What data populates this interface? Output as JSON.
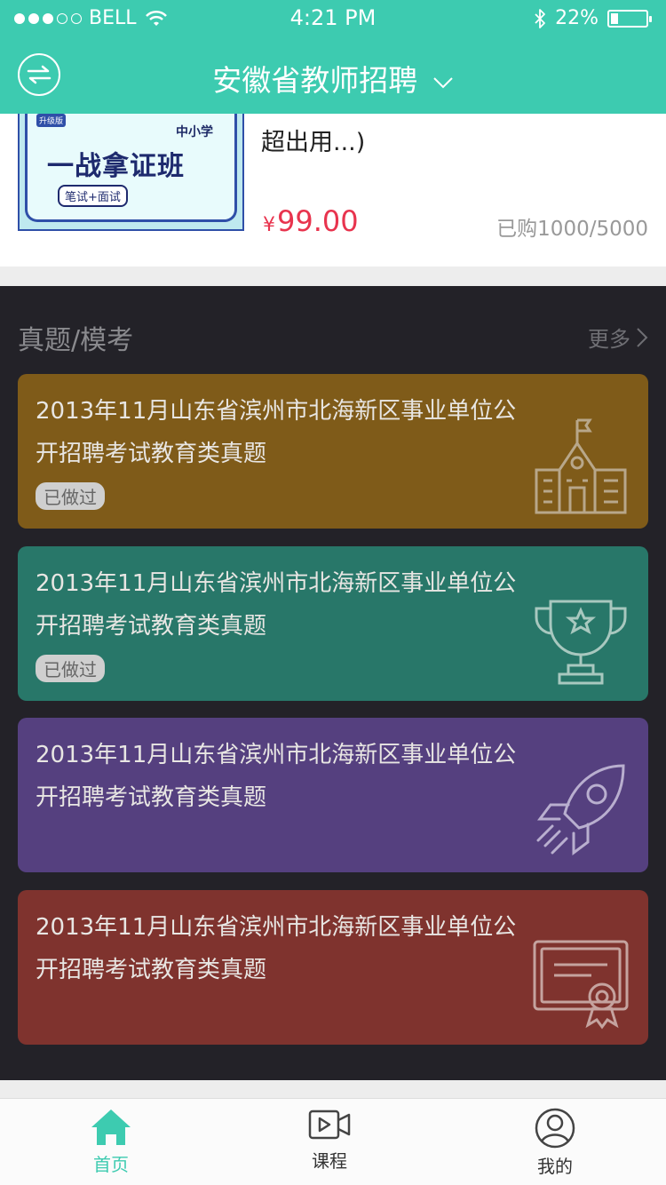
{
  "status_bar": {
    "carrier": "BELL",
    "time": "4:21 PM",
    "battery": "22%",
    "battery_level": 0.22
  },
  "nav": {
    "title": "安徽省教师招聘"
  },
  "product": {
    "image_badge": "升级版",
    "image_school": "中小学",
    "image_main": "一战拿证班",
    "image_sub": "笔试+面试",
    "title_tail": "超出用...)",
    "price": "99.00",
    "currency": "¥",
    "sold": "已购1000/5000"
  },
  "exam_section": {
    "title": "真题/模考",
    "more": "更多",
    "cards": [
      {
        "title": "2013年11月山东省滨州市北海新区事业单位公开招聘考试教育类真题",
        "tag": "已做过",
        "color": "#7F5B19",
        "icon": "school-building-icon"
      },
      {
        "title": "2013年11月山东省滨州市北海新区事业单位公开招聘考试教育类真题",
        "tag": "已做过",
        "color": "#287769",
        "icon": "trophy-icon"
      },
      {
        "title": "2013年11月山东省滨州市北海新区事业单位公开招聘考试教育类真题",
        "tag": "",
        "color": "#55407F",
        "icon": "rocket-icon"
      },
      {
        "title": "2013年11月山东省滨州市北海新区事业单位公开招聘考试教育类真题",
        "tag": "",
        "color": "#7F332E",
        "icon": "certificate-icon"
      }
    ]
  },
  "tabbar": {
    "items": [
      {
        "label": "首页",
        "icon": "home-icon",
        "active": true
      },
      {
        "label": "课程",
        "icon": "video-icon",
        "active": false
      },
      {
        "label": "我的",
        "icon": "user-icon",
        "active": false
      }
    ],
    "accent": "#3dcbb0"
  }
}
